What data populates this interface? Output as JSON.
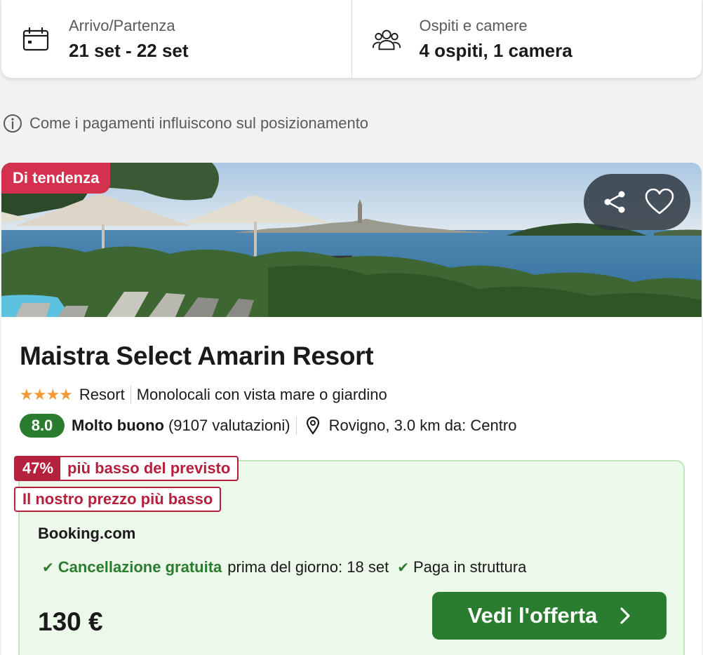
{
  "search": {
    "dates": {
      "label": "Arrivo/Partenza",
      "value": "21 set - 22 set",
      "icon": "calendar-icon"
    },
    "guests": {
      "label": "Ospiti e camere",
      "value": "4 ospiti, 1 camera",
      "icon": "guests-icon"
    }
  },
  "info": {
    "text": "Come i pagamenti influiscono sul posizionamento",
    "icon": "info-icon"
  },
  "hotel": {
    "badge": "Di tendenza",
    "name": "Maistra Select Amarin Resort",
    "stars": "★★★★",
    "star_count": 4,
    "type": "Resort",
    "room_type": "Monolocali con vista mare o giardino",
    "rating": "8.0",
    "rating_label": "Molto buono",
    "reviews": "(9107 valutazioni)",
    "location": "Rovigno, 3.0 km da: Centro"
  },
  "offer": {
    "discount_pct": "47%",
    "discount_text": "più basso del previsto",
    "lowest_tag": "Il nostro prezzo più basso",
    "provider": "Booking.com",
    "perk1_strong": "Cancellazione gratuita",
    "perk1_rest": "prima del giorno: 18 set",
    "perk2": "Paga in struttura",
    "price": "130 €",
    "cta": "Vedi l'offerta"
  },
  "colors": {
    "accent_green": "#2a7d2e",
    "trend_red": "#d4314e",
    "discount_red": "#b3213c",
    "offer_bg": "#ecf8ea",
    "star_orange": "#f39a36"
  }
}
